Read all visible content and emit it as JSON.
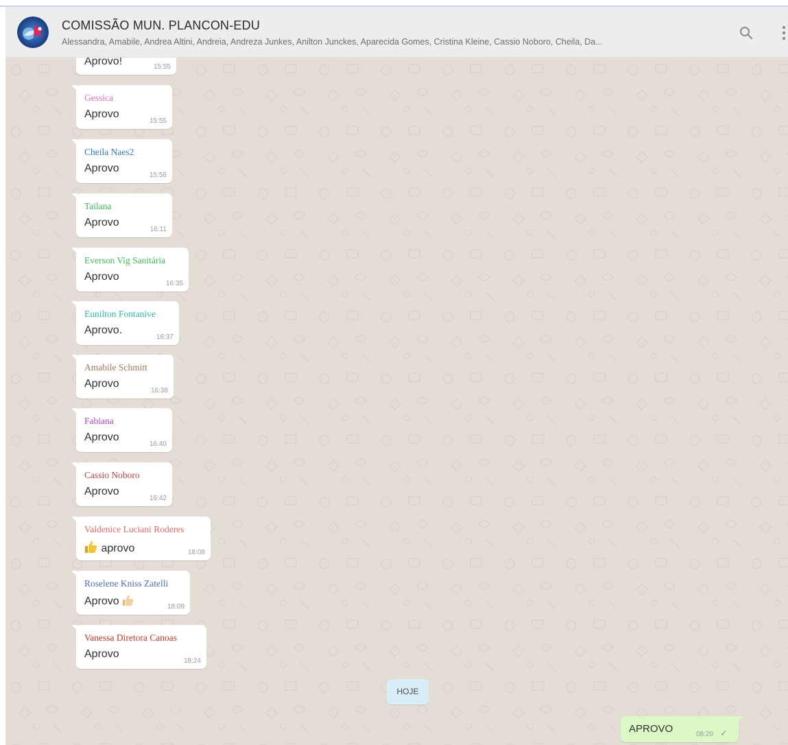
{
  "header": {
    "title": "COMISSÃO MUN. PLANCON-EDU",
    "participants": "Alessandra, Amabile, Andrea Altini, Andreia, Andreza Junkes, Anilton Junckes, Aparecida Gomes, Cristina Kleine, Cassio Noboro, Cheila, Da...",
    "search_icon": "search-icon",
    "menu_icon": "more-vertical-icon"
  },
  "messages": [
    {
      "sender": "",
      "text": "Aprovo!",
      "time": "15:55",
      "color": "#303030"
    },
    {
      "sender": "Gessica",
      "text": "Aprovo",
      "time": "15:55",
      "color": "#e36fb3"
    },
    {
      "sender": "Cheila Naes2",
      "text": "Aprovo",
      "time": "15:58",
      "color": "#2f7ac0"
    },
    {
      "sender": "Tailana",
      "text": "Aprovo",
      "time": "16:11",
      "color": "#3fb85a"
    },
    {
      "sender": "Everson Vig Sanitária",
      "text": "Aprovo",
      "time": "16:35",
      "color": "#3fb85a"
    },
    {
      "sender": "Eunilton Fontanive",
      "text": "Aprovo.",
      "time": "16:37",
      "color": "#2fb8a6"
    },
    {
      "sender": "Amabile Schmitt",
      "text": "Aprovo",
      "time": "16:38",
      "color": "#a3765b"
    },
    {
      "sender": "Fabiana",
      "text": "Aprovo",
      "time": "16:40",
      "color": "#a84ab8"
    },
    {
      "sender": "Cassio Noboro",
      "text": "Aprovo",
      "time": "16:42",
      "color": "#b8453d"
    },
    {
      "sender": "Valdenice Luciani Roderes",
      "text": "aprovo",
      "time": "18:08",
      "color": "#e06a6a"
    },
    {
      "sender": "Roselene Kniss Zatelli",
      "text": "Aprovo",
      "time": "18:09",
      "color": "#4f6fb0"
    },
    {
      "sender": "Vanessa Diretora Canoas",
      "text": "Aprovo",
      "time": "18:24",
      "color": "#c0392b"
    }
  ],
  "date_divider": "HOJE",
  "outgoing": {
    "text": "APROVO",
    "time": "08:20",
    "status_icon": "single-check-icon"
  },
  "colors": {
    "chat_bg": "#e4ddd5",
    "header_bg": "#ededed",
    "outgoing_bg": "#dcf8c6",
    "date_chip_bg": "#d9eef7"
  }
}
